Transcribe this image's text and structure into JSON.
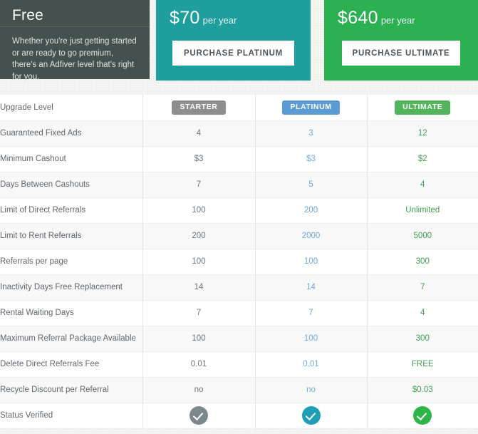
{
  "cards": {
    "free": {
      "title": "Free",
      "description": "Whether you're just getting started or are ready to go premium, there's an Adfiver level that's right for you."
    },
    "platinum": {
      "price": "$70",
      "period": "per year",
      "button": "PURCHASE PLATINUM",
      "color": "#1f9e9e"
    },
    "ultimate": {
      "price": "$640",
      "period": "per year",
      "button": "PURCHASE ULTIMATE",
      "color": "#2cb152"
    }
  },
  "table": {
    "header": {
      "label": "Upgrade Level",
      "starter_badge": "STARTER",
      "platinum_badge": "PLATINUM",
      "ultimate_badge": "ULTIMATE",
      "starter_color": "#8e8e8e",
      "platinum_color": "#5b9bd5",
      "ultimate_color": "#54b45e"
    },
    "rows": [
      {
        "label": "Guaranteed Fixed Ads",
        "starter": "4",
        "platinum": "3",
        "ultimate": "12"
      },
      {
        "label": "Minimum Cashout",
        "starter": "$3",
        "platinum": "$3",
        "ultimate": "$2"
      },
      {
        "label": "Days Between Cashouts",
        "starter": "7",
        "platinum": "5",
        "ultimate": "4"
      },
      {
        "label": "Limit of Direct Referrals",
        "starter": "100",
        "platinum": "200",
        "ultimate": "Unlimited"
      },
      {
        "label": "Limit to Rent Referrals",
        "starter": "200",
        "platinum": "2000",
        "ultimate": "5000"
      },
      {
        "label": "Referrals per page",
        "starter": "100",
        "platinum": "100",
        "ultimate": "300"
      },
      {
        "label": "Inactivity Days Free Replacement",
        "starter": "14",
        "platinum": "14",
        "ultimate": "7"
      },
      {
        "label": "Rental Waiting Days",
        "starter": "7",
        "platinum": "7",
        "ultimate": "4"
      },
      {
        "label": "Maximum Referral Package Available",
        "starter": "100",
        "platinum": "100",
        "ultimate": "300"
      },
      {
        "label": "Delete Direct Referrals Fee",
        "starter": "0.01",
        "platinum": "0.01",
        "ultimate": "FREE"
      },
      {
        "label": "Recycle Discount per Referral",
        "starter": "no",
        "platinum": "no",
        "ultimate": "$0.03"
      }
    ],
    "status_row": {
      "label": "Status Verified",
      "starter_icon": "check-circle-icon",
      "platinum_icon": "check-circle-icon",
      "ultimate_icon": "check-circle-icon"
    }
  }
}
